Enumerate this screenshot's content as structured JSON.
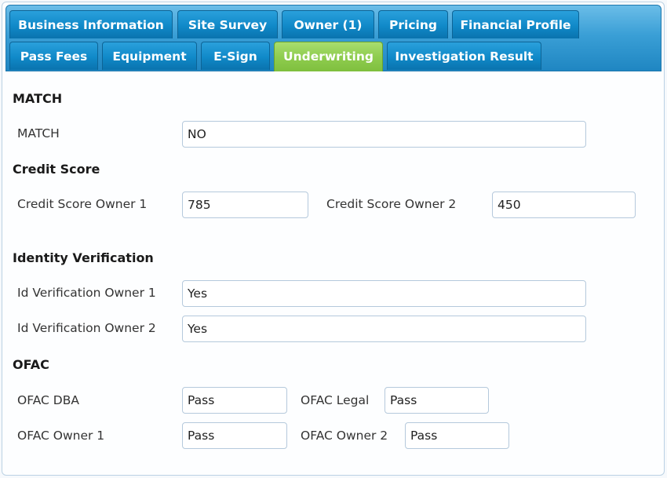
{
  "tabs": {
    "row1": [
      "Business Information",
      "Site Survey",
      "Owner (1)",
      "Pricing",
      "Financial Profile"
    ],
    "row2": [
      "Pass Fees",
      "Equipment",
      "E-Sign",
      "Underwriting",
      "Investigation Result"
    ],
    "active": "Underwriting"
  },
  "sections": {
    "match": {
      "title": "MATCH",
      "label": "MATCH",
      "value": "NO"
    },
    "credit": {
      "title": "Credit Score",
      "owner1_label": "Credit Score Owner 1",
      "owner1_value": "785",
      "owner2_label": "Credit Score Owner 2",
      "owner2_value": "450"
    },
    "identity": {
      "title": "Identity Verification",
      "owner1_label": "Id Verification Owner 1",
      "owner1_value": "Yes",
      "owner2_label": "Id Verification Owner 2",
      "owner2_value": "Yes"
    },
    "ofac": {
      "title": "OFAC",
      "dba_label": "OFAC DBA",
      "dba_value": "Pass",
      "legal_label": "OFAC Legal",
      "legal_value": "Pass",
      "owner1_label": "OFAC Owner 1",
      "owner1_value": "Pass",
      "owner2_label": "OFAC Owner 2",
      "owner2_value": "Pass"
    }
  },
  "colors": {
    "tab_blue": "#1089c8",
    "tab_active_green": "#8fcd4f",
    "field_border": "#b5c9dc"
  }
}
